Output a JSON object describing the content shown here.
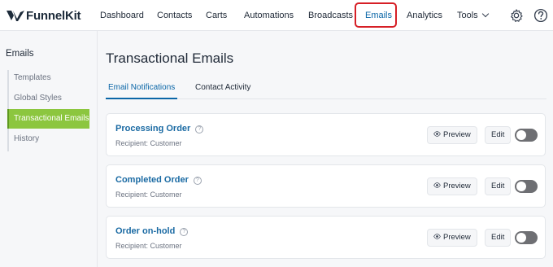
{
  "brand": {
    "name": "FunnelKit"
  },
  "nav": {
    "items": [
      {
        "label": "Dashboard"
      },
      {
        "label": "Contacts"
      },
      {
        "label": "Carts"
      },
      {
        "label": "Automations"
      },
      {
        "label": "Broadcasts"
      },
      {
        "label": "Emails"
      },
      {
        "label": "Analytics"
      },
      {
        "label": "Tools"
      }
    ],
    "active": "Emails",
    "highlight_color": "#d61f26",
    "icons": [
      "gear-icon",
      "help-icon"
    ]
  },
  "sidebar": {
    "title": "Emails",
    "items": [
      {
        "label": "Templates"
      },
      {
        "label": "Global Styles"
      },
      {
        "label": "Transactional Emails"
      },
      {
        "label": "History"
      }
    ],
    "active": "Transactional Emails",
    "active_color": "#8cc63f"
  },
  "page": {
    "title": "Transactional Emails",
    "tabs": [
      {
        "label": "Email Notifications"
      },
      {
        "label": "Contact Activity"
      }
    ],
    "active_tab": "Email Notifications"
  },
  "emails": [
    {
      "title": "Processing Order",
      "recipient": "Recipient: Customer",
      "preview_label": "Preview",
      "edit_label": "Edit",
      "enabled": false
    },
    {
      "title": "Completed Order",
      "recipient": "Recipient: Customer",
      "preview_label": "Preview",
      "edit_label": "Edit",
      "enabled": false
    },
    {
      "title": "Order on-hold",
      "recipient": "Recipient: Customer",
      "preview_label": "Preview",
      "edit_label": "Edit",
      "enabled": false
    }
  ]
}
